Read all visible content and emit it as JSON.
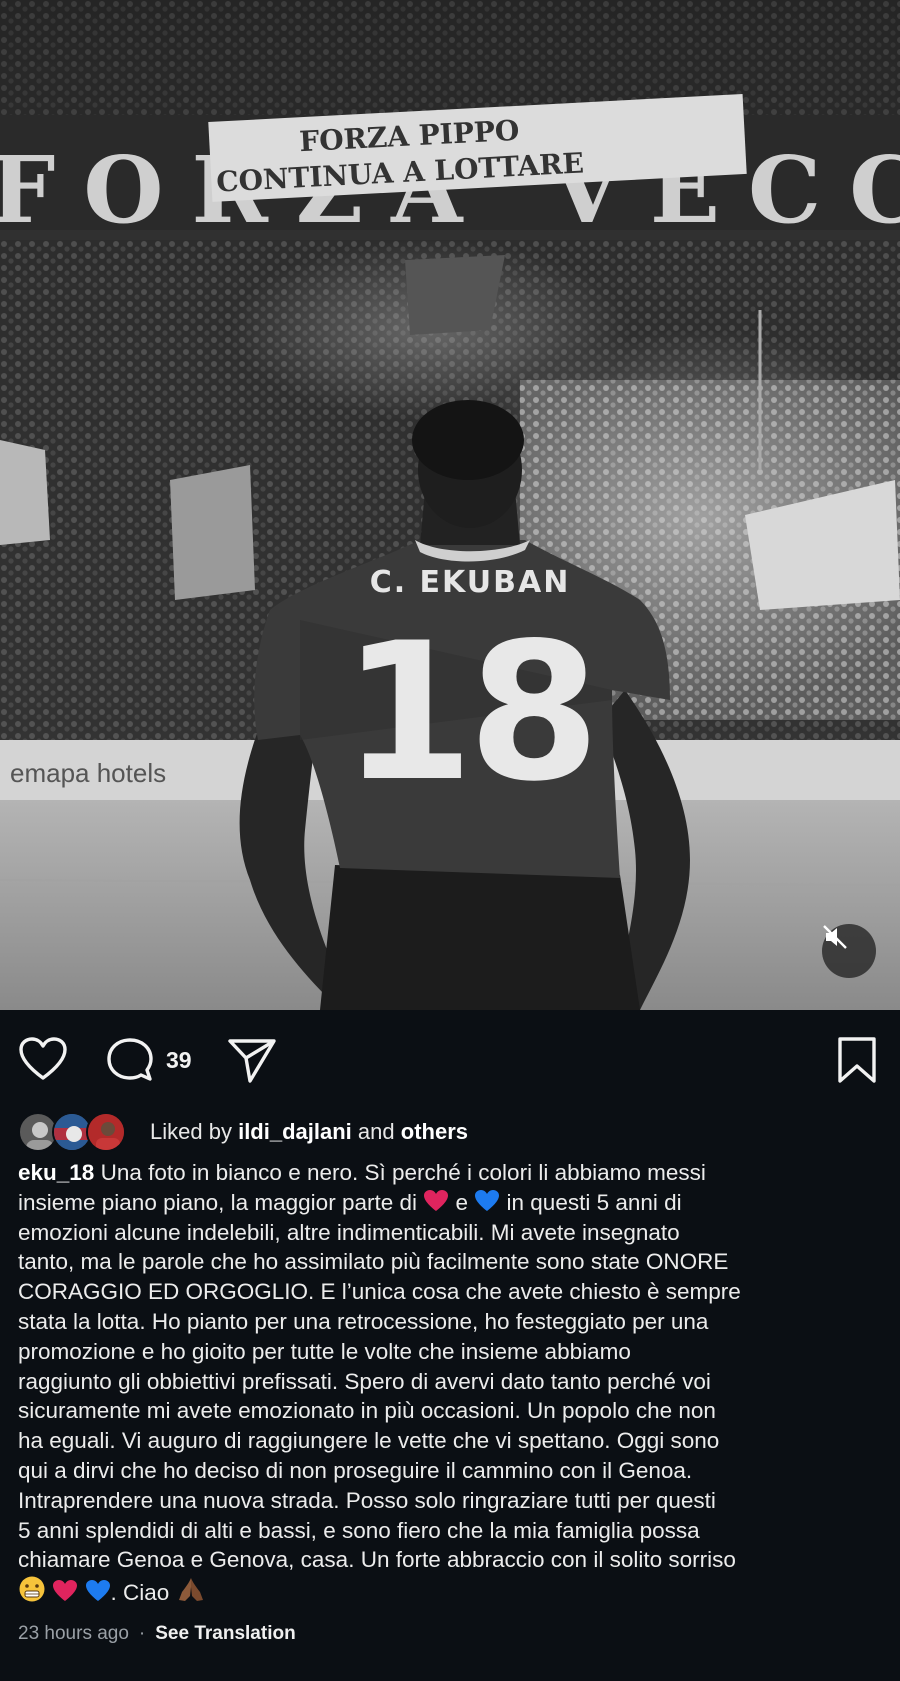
{
  "post": {
    "jersey": {
      "name": "C. EKUBAN",
      "number": "18"
    },
    "banner": {
      "big_text": "FORZA VECCHIO",
      "line1": "FORZA PIPPO",
      "line2": "CONTINUA A LOTTARE"
    },
    "board_text": "emapa hotels"
  },
  "actions": {
    "comment_count": "39",
    "icons": [
      "heart-icon",
      "comment-icon",
      "share-icon",
      "bookmark-icon",
      "mute-icon"
    ]
  },
  "likes": {
    "prefix": "Liked by",
    "user": "ildi_dajlani",
    "and": "and",
    "others": "others"
  },
  "caption": {
    "username": "eku_18",
    "lines": [
      " Una foto in bianco e nero. Sì perché i colori li abbiamo messi",
      "insieme piano piano, la maggior parte di ",
      " e ",
      " in questi 5 anni di",
      "emozioni alcune indelebili, altre indimenticabili. Mi avete insegnato",
      "tanto, ma le parole che ho assimilato più facilmente sono state ONORE",
      "CORAGGIO ED ORGOGLIO. E l’unica cosa che avete chiesto è sempre",
      "stata la lotta. Ho pianto per una retrocessione, ho festeggiato per una",
      "promozione e ho gioito per tutte le volte che insieme abbiamo",
      "raggiunto gli obbiettivi prefissati. Spero di avervi dato tanto perché voi",
      "sicuramente mi avete emozionato in più occasioni.  Un popolo che non",
      "ha eguali. Vi auguro di raggiungere le vette che vi spettano. Oggi sono",
      "qui a dirvi che ho deciso di non proseguire il cammino con il Genoa.",
      "Intraprendere una nuova strada. Posso solo ringraziare tutti per questi",
      "5 anni splendidi di alti e bassi, e sono fiero che la mia famiglia possa",
      "chiamare Genoa e Genova, casa. Un forte abbraccio con il solito sorriso",
      ". Ciao "
    ]
  },
  "meta": {
    "time": "23 hours ago",
    "separator": "·",
    "translate": "See Translation"
  },
  "colors": {
    "background": "#0b0f14",
    "heart": "#e0245e",
    "blue_heart": "#1d7bf0"
  }
}
